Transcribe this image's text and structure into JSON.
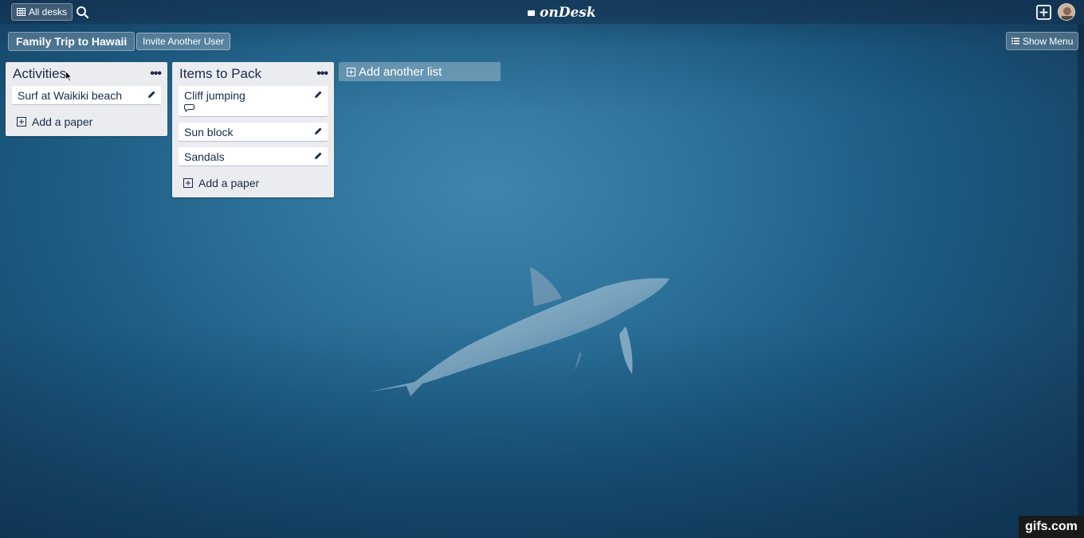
{
  "topbar": {
    "desks_label": "All desks",
    "logo_text": "onDesk"
  },
  "board": {
    "title": "Family Trip to Hawaii",
    "invite_label": "Invite Another User",
    "menu_label": "Show Menu"
  },
  "lists": [
    {
      "title": "Activities",
      "cards": [
        {
          "text": "Surf at Waikiki beach"
        }
      ],
      "add_label": "Add a paper"
    },
    {
      "title": "Items to Pack",
      "cards": [
        {
          "text": "Cliff jumping",
          "has_comment": true
        },
        {
          "text": "Sun block"
        },
        {
          "text": "Sandals"
        }
      ],
      "add_label": "Add a paper"
    }
  ],
  "add_list_label": "Add another list",
  "watermark": "gifs.com",
  "colors": {
    "list_bg": "#ebecf0",
    "card_text": "#172b4d",
    "ocean": "#2a6f97"
  }
}
